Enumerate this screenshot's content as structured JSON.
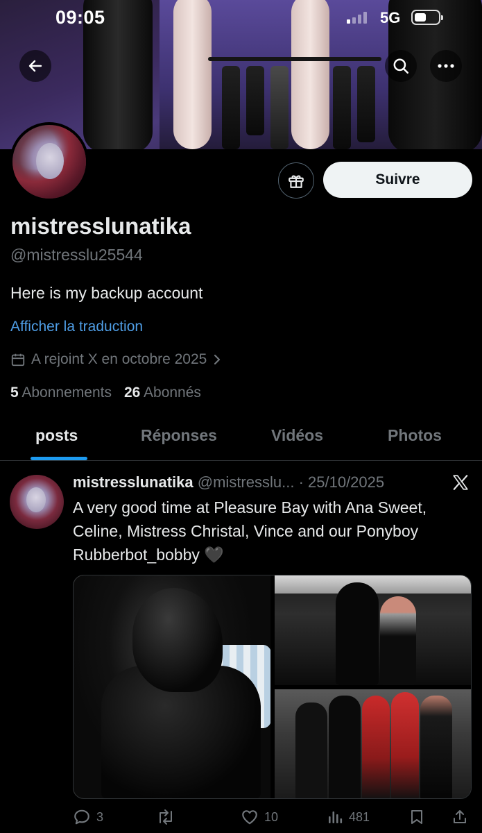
{
  "status_bar": {
    "time": "09:05",
    "network": "5G"
  },
  "profile": {
    "display_name": "mistresslunatika",
    "handle": "@mistresslu25544",
    "bio": "Here is my backup account",
    "translate_link": "Afficher la traduction",
    "joined": "A rejoint X en octobre 2025",
    "following_count": "5",
    "following_label": "Abonnements",
    "followers_count": "26",
    "followers_label": "Abonnés",
    "follow_button": "Suivre"
  },
  "tabs": [
    {
      "label": "posts",
      "active": true
    },
    {
      "label": "Réponses",
      "active": false
    },
    {
      "label": "Vidéos",
      "active": false
    },
    {
      "label": "Photos",
      "active": false
    }
  ],
  "post": {
    "author_name": "mistresslunatika",
    "author_handle": "@mistresslu...",
    "date": "· 25/10/2025",
    "text": "A very good time at Pleasure Bay with Ana Sweet, Celine, Mistress Christal, Vince and our Ponyboy Rubberbot_bobby 🖤",
    "replies": "3",
    "likes": "10",
    "views": "481"
  },
  "icons": {
    "back": "arrow-left-icon",
    "search": "search-icon",
    "more": "more-dots-icon",
    "gift": "gift-icon",
    "calendar": "calendar-icon",
    "x_logo": "x-logo-icon",
    "reply": "reply-icon",
    "repost": "repost-icon",
    "like": "heart-icon",
    "views": "views-icon",
    "bookmark": "bookmark-icon",
    "share": "share-icon"
  },
  "colors": {
    "accent": "#1d9bf0",
    "link": "#4f9ee6",
    "muted": "#71767b",
    "text": "#e7e9ea",
    "background": "#000000"
  }
}
